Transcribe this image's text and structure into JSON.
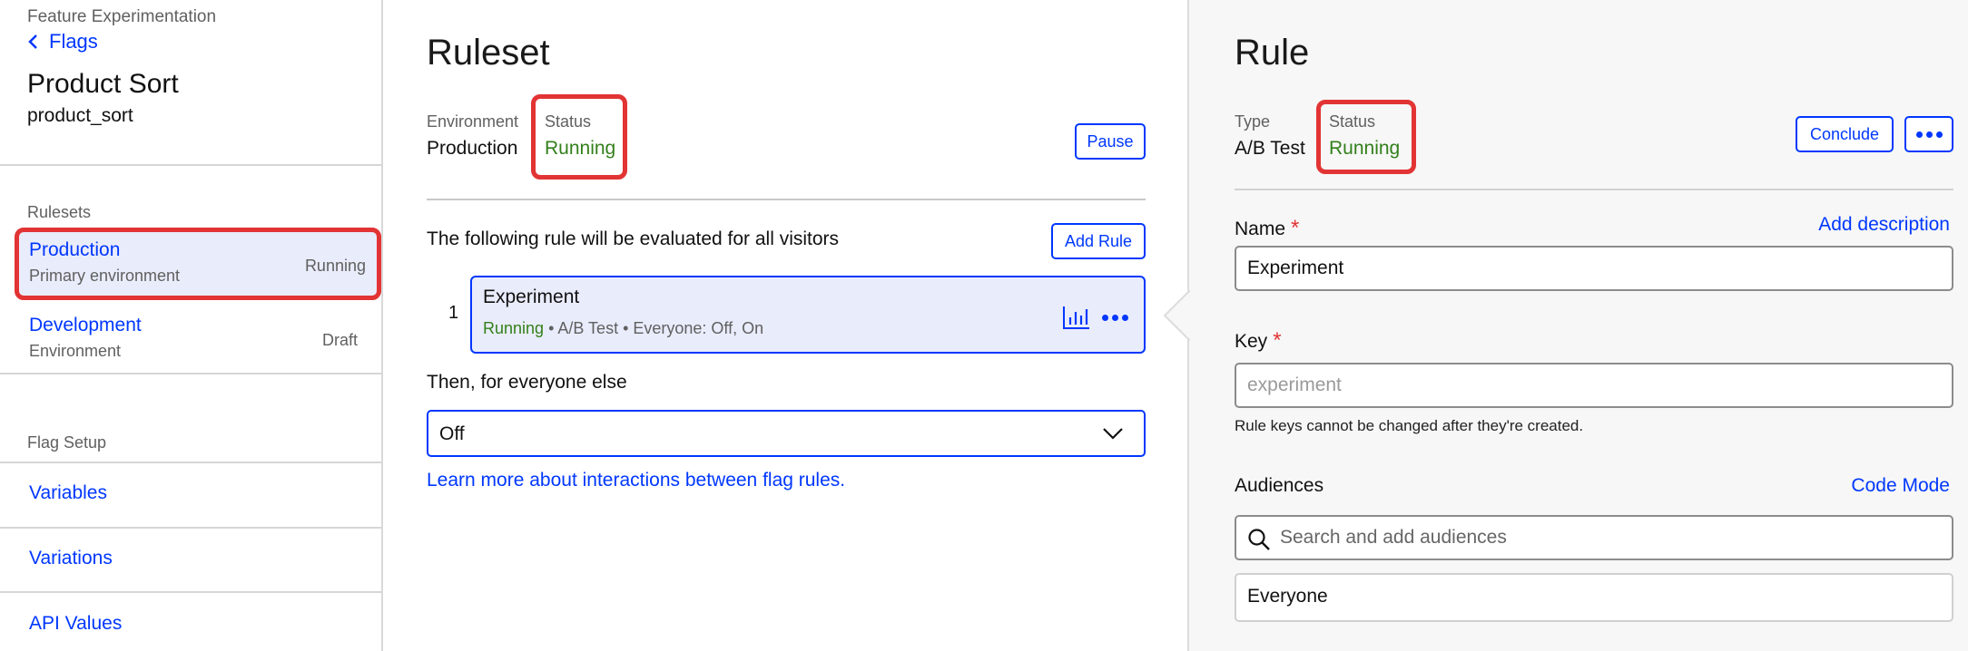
{
  "sidebar": {
    "app_name": "Feature Experimentation",
    "back_label": "Flags",
    "flag_name": "Product Sort",
    "flag_key": "product_sort",
    "rulesets_heading": "Rulesets",
    "rulesets": [
      {
        "name": "Production",
        "description": "Primary environment",
        "status": "Running"
      },
      {
        "name": "Development",
        "description": "Environment",
        "status": "Draft"
      }
    ],
    "flag_setup_heading": "Flag Setup",
    "setup_links": [
      "Variables",
      "Variations",
      "API Values"
    ]
  },
  "ruleset": {
    "title": "Ruleset",
    "environment_label": "Environment",
    "environment_value": "Production",
    "status_label": "Status",
    "status_value": "Running",
    "pause_label": "Pause",
    "evaluated_text": "The following rule will be evaluated for all visitors",
    "add_rule_label": "Add Rule",
    "rule": {
      "index": "1",
      "name": "Experiment",
      "status": "Running",
      "meta": " • A/B Test • Everyone: Off, On"
    },
    "everyone_else_text": "Then, for everyone else",
    "fallback_value": "Off",
    "learn_more": "Learn more about interactions between flag rules."
  },
  "rule_panel": {
    "title": "Rule",
    "type_label": "Type",
    "type_value": "A/B Test",
    "status_label": "Status",
    "status_value": "Running",
    "conclude_label": "Conclude",
    "name_label": "Name",
    "add_description": "Add description",
    "name_value": "Experiment",
    "key_label": "Key",
    "key_placeholder": "experiment",
    "key_help": "Rule keys cannot be changed after they're created.",
    "audiences_label": "Audiences",
    "code_mode": "Code Mode",
    "audience_search_placeholder": "Search and add audiences",
    "audience_selected": "Everyone"
  },
  "colors": {
    "link_blue": "#0037ff",
    "running_green": "#33801b",
    "highlight_red": "#e23434",
    "active_bg": "#e9ecfb"
  }
}
